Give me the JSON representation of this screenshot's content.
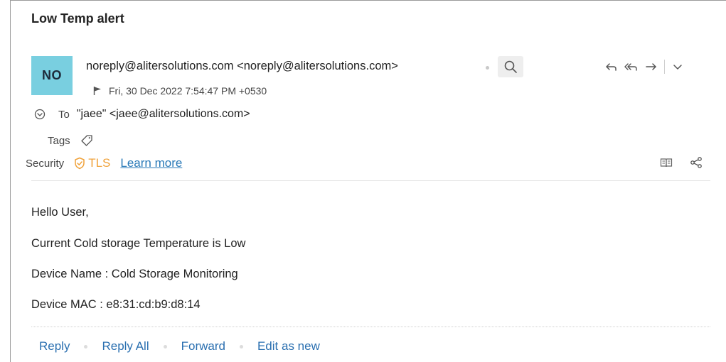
{
  "email": {
    "subject": "Low Temp alert",
    "avatar_initials": "NO",
    "from": "noreply@alitersolutions.com <noreply@alitersolutions.com>",
    "date": "Fri, 30 Dec 2022 7:54:47 PM +0530",
    "to_label": "To",
    "to_value": "\"jaee\" <jaee@alitersolutions.com>",
    "tags_label": "Tags",
    "security_label": "Security",
    "security_value": "TLS",
    "learn_more": "Learn more"
  },
  "body": {
    "lines": [
      "Hello User,",
      "Current Cold storage Temperature is Low",
      "Device Name :  Cold Storage Monitoring",
      "Device MAC : e8:31:cd:b9:d8:14"
    ]
  },
  "footer": {
    "reply": "Reply",
    "reply_all": "Reply All",
    "forward": "Forward",
    "edit_as_new": "Edit as new"
  },
  "colors": {
    "avatar_bg": "#79cfe0",
    "tls_accent": "#f0a23a",
    "link": "#2a6fb0"
  },
  "icons": [
    "search-icon",
    "reply-icon",
    "reply-all-icon",
    "forward-icon",
    "chevron-down-icon",
    "flag-icon",
    "expand-circle-icon",
    "tag-icon",
    "shield-check-icon",
    "reader-icon",
    "share-icon"
  ]
}
